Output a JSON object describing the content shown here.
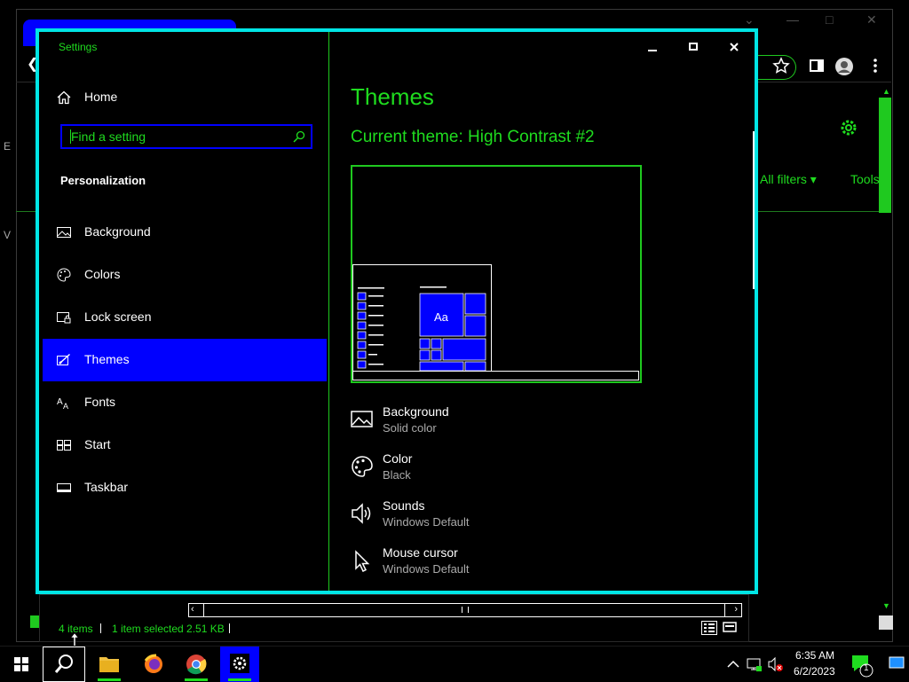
{
  "background_browser": {
    "all_filters_label": "All filters",
    "tools_label": "Tools",
    "left_letter_1": "E",
    "left_letter_2": "V"
  },
  "settings": {
    "window_title": "Settings",
    "nav": {
      "home_label": "Home",
      "search_placeholder": "Find a setting",
      "section_title": "Personalization",
      "items": [
        {
          "label": "Background",
          "icon": "picture-icon"
        },
        {
          "label": "Colors",
          "icon": "palette-icon"
        },
        {
          "label": "Lock screen",
          "icon": "lock-screen-icon"
        },
        {
          "label": "Themes",
          "icon": "themes-icon",
          "selected": true
        },
        {
          "label": "Fonts",
          "icon": "fonts-icon"
        },
        {
          "label": "Start",
          "icon": "start-icon"
        },
        {
          "label": "Taskbar",
          "icon": "taskbar-icon"
        }
      ]
    },
    "content": {
      "heading": "Themes",
      "current_theme": "Current theme: High Contrast #2",
      "preview_tile_text": "Aa",
      "properties": [
        {
          "name": "Background",
          "value": "Solid color",
          "icon": "picture-icon"
        },
        {
          "name": "Color",
          "value": "Black",
          "icon": "palette-icon"
        },
        {
          "name": "Sounds",
          "value": "Windows Default",
          "icon": "speaker-icon"
        },
        {
          "name": "Mouse cursor",
          "value": "Windows Default",
          "icon": "cursor-icon"
        }
      ]
    }
  },
  "explorer_status": {
    "item_count": "4 items",
    "selection": "1 item selected  2.51 KB"
  },
  "taskbar": {
    "time": "6:35 AM",
    "date": "6/2/2023",
    "notification_count": "1"
  },
  "colors": {
    "accent_green": "#1fdc1f",
    "selection_blue": "#0000ff",
    "window_border_cyan": "#00e5e5"
  }
}
